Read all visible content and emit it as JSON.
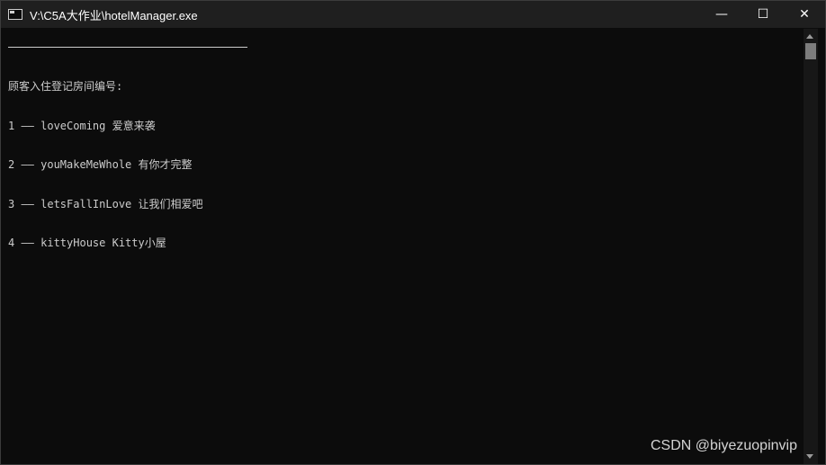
{
  "window": {
    "title": "V:\\C5A大作业\\hotelManager.exe",
    "controls": {
      "minimize": "—",
      "maximize": "☐",
      "close": "✕"
    }
  },
  "console": {
    "lines": [
      "顾客入住登记房间编号:",
      "1 —— loveComing 爱意来袭",
      "2 —— youMakeMeWhole 有你才完整",
      "3 —— letsFallInLove 让我们相爱吧",
      "4 —— kittyHouse Kitty小屋"
    ]
  },
  "watermark": "CSDN @biyezuopinvip",
  "colors": {
    "background": "#0c0c0c",
    "titlebar": "#1f1f1f",
    "text": "#cccccc"
  }
}
